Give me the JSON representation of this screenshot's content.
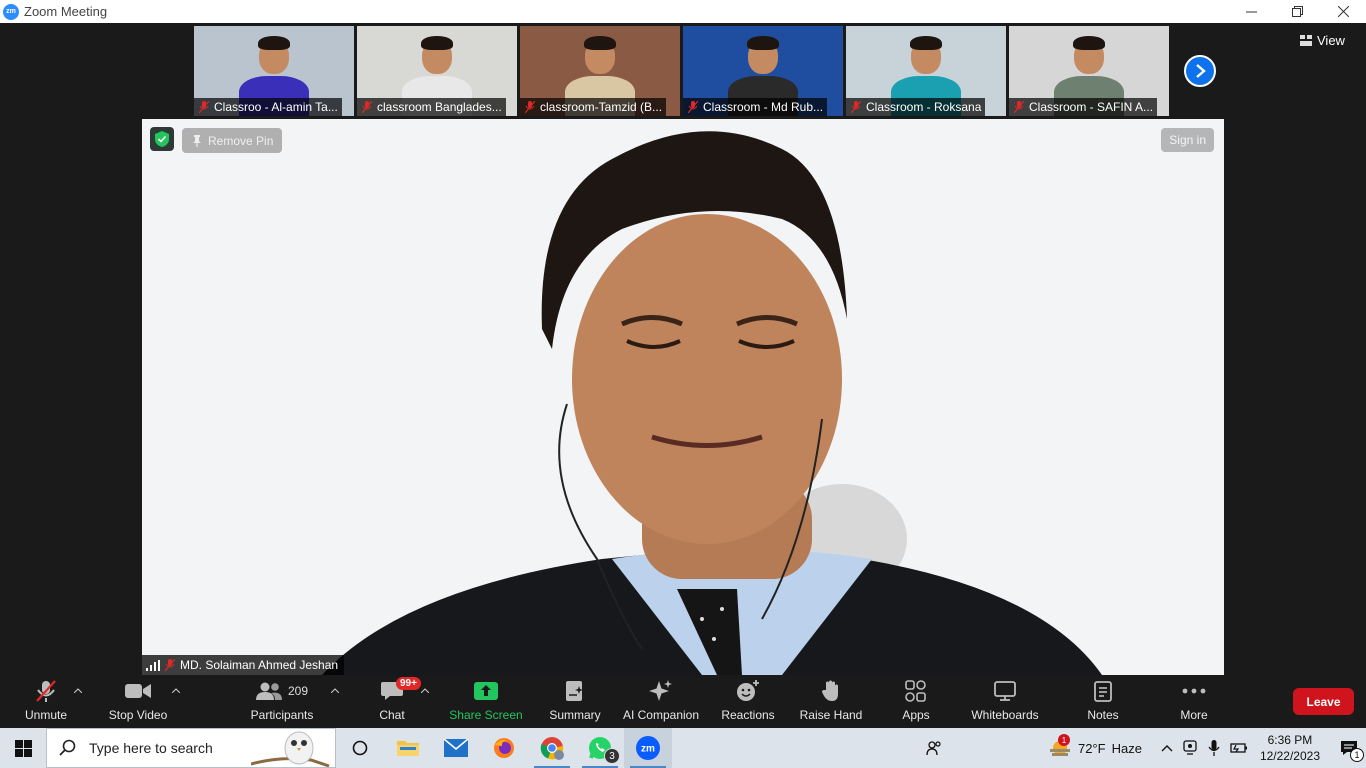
{
  "window": {
    "title": "Zoom Meeting",
    "logo_text": "zm"
  },
  "thumbnails": [
    {
      "name": "Classroo - Al-amin Ta...",
      "bg": "#b9c4cf",
      "body": "#3a2fb8"
    },
    {
      "name": "classroom Banglades...",
      "bg": "#d8d8d4",
      "body": "#e8e8e8"
    },
    {
      "name": "classroom-Tamzid (B...",
      "bg": "#8a5a44",
      "body": "#d9c7a4"
    },
    {
      "name": "Classroom - Md Rub...",
      "bg": "#1f4ea0",
      "body": "#2a2a2a"
    },
    {
      "name": "Classroom - Roksana",
      "bg": "#c7d3d8",
      "body": "#1aa0b0"
    },
    {
      "name": "Classroom - SAFIN A...",
      "bg": "#d6d6d6",
      "body": "#6e8070"
    }
  ],
  "view_label": "View",
  "main": {
    "remove_pin": "Remove Pin",
    "sign_in": "Sign in",
    "speaker_name": "MD. Solaiman Ahmed Jeshan"
  },
  "toolbar": {
    "unmute": "Unmute",
    "stop_video": "Stop Video",
    "participants": "Participants",
    "participants_count": "209",
    "chat": "Chat",
    "chat_badge": "99+",
    "share_screen": "Share Screen",
    "summary": "Summary",
    "ai_companion": "AI Companion",
    "reactions": "Reactions",
    "raise_hand": "Raise Hand",
    "apps": "Apps",
    "whiteboards": "Whiteboards",
    "notes": "Notes",
    "more": "More",
    "leave": "Leave",
    "share_color": "#22c55e",
    "leave_color": "#d0141d"
  },
  "taskbar": {
    "search_placeholder": "Type here to search",
    "whatsapp_badge": "3",
    "weather_badge": "1",
    "temperature": "72°F",
    "weather": "Haze",
    "time": "6:36 PM",
    "date": "12/22/2023",
    "notification_count": "1"
  }
}
